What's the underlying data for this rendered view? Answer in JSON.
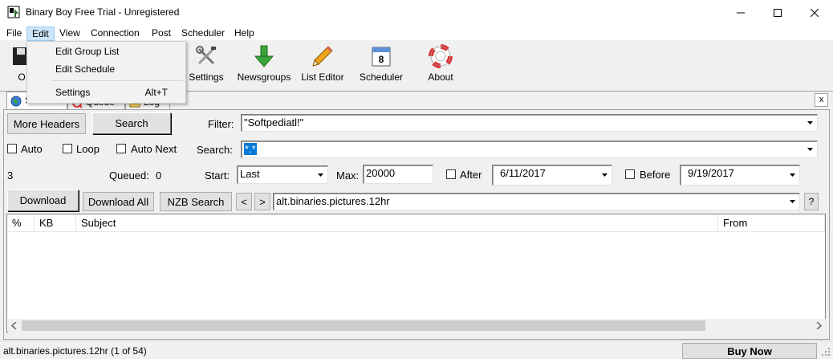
{
  "window": {
    "title": "Binary Boy Free Trial - Unregistered",
    "minimize_icon": "minimize-icon",
    "maximize_icon": "maximize-icon",
    "close_icon": "close-icon"
  },
  "menubar": {
    "items": [
      "File",
      "Edit",
      "View",
      "Connection",
      "Post",
      "Scheduler",
      "Help"
    ]
  },
  "edit_menu": {
    "items": [
      {
        "label": "Edit Group List",
        "shortcut": ""
      },
      {
        "label": "Edit Schedule",
        "shortcut": ""
      },
      {
        "label": "Settings",
        "shortcut": "Alt+T"
      }
    ]
  },
  "toolbar": {
    "partial_label": "O",
    "buttons": [
      {
        "label": "Settings",
        "icon": "settings-tools-icon"
      },
      {
        "label": "Newsgroups",
        "icon": "download-arrow-icon"
      },
      {
        "label": "List Editor",
        "icon": "pencil-icon"
      },
      {
        "label": "Scheduler",
        "icon": "calendar-icon"
      },
      {
        "label": "About",
        "icon": "lifebuoy-icon"
      }
    ],
    "calendar_day": "8"
  },
  "tabs": [
    {
      "label": "Search",
      "icon": "globe-icon",
      "active": true
    },
    {
      "label": "Queue",
      "icon": "queue-icon",
      "active": false
    },
    {
      "label": "Log",
      "icon": "log-icon",
      "active": false
    }
  ],
  "close_tab_label": "x",
  "search_panel": {
    "more_headers_label": "More Headers",
    "search_button_label": "Search",
    "filter_label": "Filter:",
    "filter_value": "\"Softpediatl!\"",
    "auto_label": "Auto",
    "loop_label": "Loop",
    "auto_next_label": "Auto Next",
    "search_label": "Search:",
    "search_value": "*.*",
    "count": "3",
    "queued_label": "Queued:",
    "queued_value": "0",
    "start_label": "Start:",
    "start_value": "Last",
    "max_label": "Max:",
    "max_value": "20000",
    "after_label": "After",
    "after_date": "6/11/2017",
    "before_label": "Before",
    "before_date": "9/19/2017",
    "download_label": "Download",
    "download_all_label": "Download All",
    "nzb_search_label": "NZB Search",
    "prev_label": "<",
    "next_label": ">",
    "group_value": "alt.binaries.pictures.12hr",
    "help_label": "?"
  },
  "listview": {
    "columns": [
      "%",
      "KB",
      "Subject",
      "From"
    ],
    "rows": []
  },
  "statusbar": {
    "text": "alt.binaries.pictures.12hr (1 of 54)",
    "buy_now_label": "Buy Now"
  },
  "colors": {
    "selection": "#0078d7",
    "menu_highlight": "#cce4f7",
    "window_bg": "#f0f0f0"
  }
}
